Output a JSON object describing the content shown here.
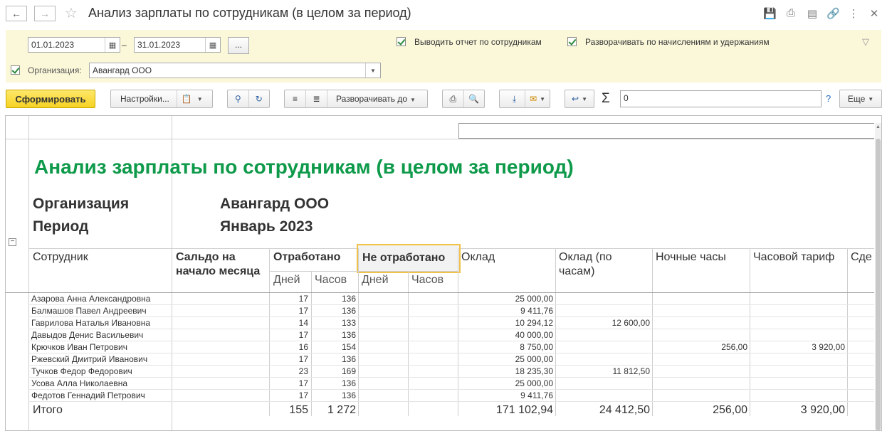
{
  "window": {
    "title": "Анализ зарплаты по сотрудникам (в целом за период)",
    "icons": [
      "save-icon",
      "print-icon",
      "preview-icon",
      "link-icon",
      "more-icon",
      "close-icon"
    ]
  },
  "filters": {
    "date_from": "01.01.2023",
    "date_dash": "–",
    "date_to": "31.01.2023",
    "period_button": "...",
    "by_employees_label": "Выводить отчет по сотрудникам",
    "expand_accruals_label": "Разворачивать по начислениям и удержаниям",
    "organization_label": "Организация:",
    "organization_value": "Авангард ООО"
  },
  "toolbar": {
    "generate": "Сформировать",
    "settings": "Настройки...",
    "expand_to": "Разворачивать до",
    "sigma": "Σ",
    "sum_value": "0",
    "help": "?",
    "more": "Еще"
  },
  "report": {
    "title": "Анализ зарплаты по сотрудникам (в целом за период)",
    "org_label": "Организация",
    "org_value": "Авангард ООО",
    "period_label": "Период",
    "period_value": "Январь 2023",
    "columns": {
      "employee": "Сотрудник",
      "balance": "Сальдо на начало месяца",
      "worked": "Отработано",
      "not_worked": "Не отработано",
      "days": "Дней",
      "hours": "Часов",
      "salary": "Оклад",
      "hourly_salary": "Оклад (по часам)",
      "night_hours": "Ночные часы",
      "hourly_rate": "Часовой тариф",
      "piece": "Сде"
    },
    "rows": [
      {
        "name": "Азарова Анна Александровна",
        "days": "17",
        "hours": "136",
        "salary": "25 000,00",
        "hourly_salary": "",
        "night": "",
        "rate": ""
      },
      {
        "name": "Балмашов Павел Андреевич",
        "days": "17",
        "hours": "136",
        "salary": "9 411,76",
        "hourly_salary": "",
        "night": "",
        "rate": ""
      },
      {
        "name": "Гаврилова Наталья Ивановна",
        "days": "14",
        "hours": "133",
        "salary": "10 294,12",
        "hourly_salary": "12 600,00",
        "night": "",
        "rate": ""
      },
      {
        "name": "Давыдов Денис Васильевич",
        "days": "17",
        "hours": "136",
        "salary": "40 000,00",
        "hourly_salary": "",
        "night": "",
        "rate": ""
      },
      {
        "name": "Крючков Иван Петрович",
        "days": "16",
        "hours": "154",
        "salary": "8 750,00",
        "hourly_salary": "",
        "night": "256,00",
        "rate": "3 920,00"
      },
      {
        "name": "Ржевский Дмитрий Иванович",
        "days": "17",
        "hours": "136",
        "salary": "25 000,00",
        "hourly_salary": "",
        "night": "",
        "rate": ""
      },
      {
        "name": "Тучков Федор Федорович",
        "days": "23",
        "hours": "169",
        "salary": "18 235,30",
        "hourly_salary": "11 812,50",
        "night": "",
        "rate": ""
      },
      {
        "name": "Усова Алла Николаевна",
        "days": "17",
        "hours": "136",
        "salary": "25 000,00",
        "hourly_salary": "",
        "night": "",
        "rate": ""
      },
      {
        "name": "Федотов Геннадий Петрович",
        "days": "17",
        "hours": "136",
        "salary": "9 411,76",
        "hourly_salary": "",
        "night": "",
        "rate": ""
      }
    ],
    "total": {
      "name": "Итого",
      "days": "155",
      "hours": "1 272",
      "salary": "171 102,94",
      "hourly_salary": "24 412,50",
      "night": "256,00",
      "rate": "3 920,00"
    }
  }
}
